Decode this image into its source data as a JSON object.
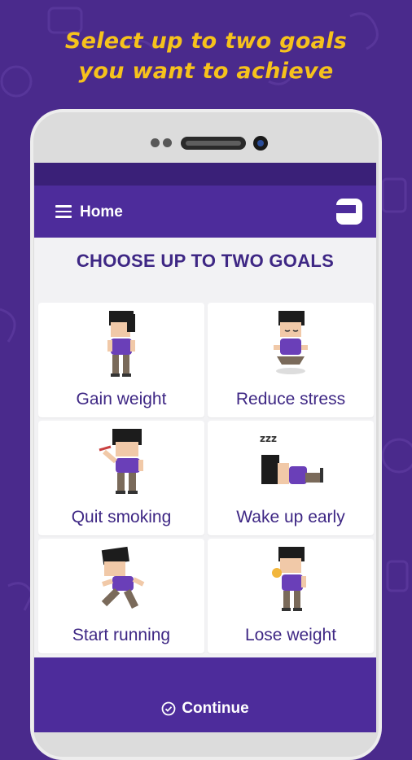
{
  "headline": {
    "line1": "Select up to two goals",
    "line2": "you want to achieve"
  },
  "app_bar": {
    "title": "Home",
    "menu_icon": "hamburger-menu-icon",
    "logo_icon": "app-logo-icon"
  },
  "section_title": "CHOOSE UP TO TWO GOALS",
  "goals": [
    {
      "label": "Gain weight",
      "icon": "standing-person"
    },
    {
      "label": "Reduce stress",
      "icon": "meditating-person"
    },
    {
      "label": "Quit smoking",
      "icon": "smoking-person"
    },
    {
      "label": "Wake up early",
      "icon": "sleeping-person"
    },
    {
      "label": "Start running",
      "icon": "running-person"
    },
    {
      "label": "Lose weight",
      "icon": "eating-person"
    }
  ],
  "footer": {
    "continue_label": "Continue",
    "continue_icon": "check-circle-icon"
  },
  "colors": {
    "background": "#4a2a8c",
    "headline": "#f6c21c",
    "app_bar": "#4d2c9b",
    "text_accent": "#3e2784"
  }
}
